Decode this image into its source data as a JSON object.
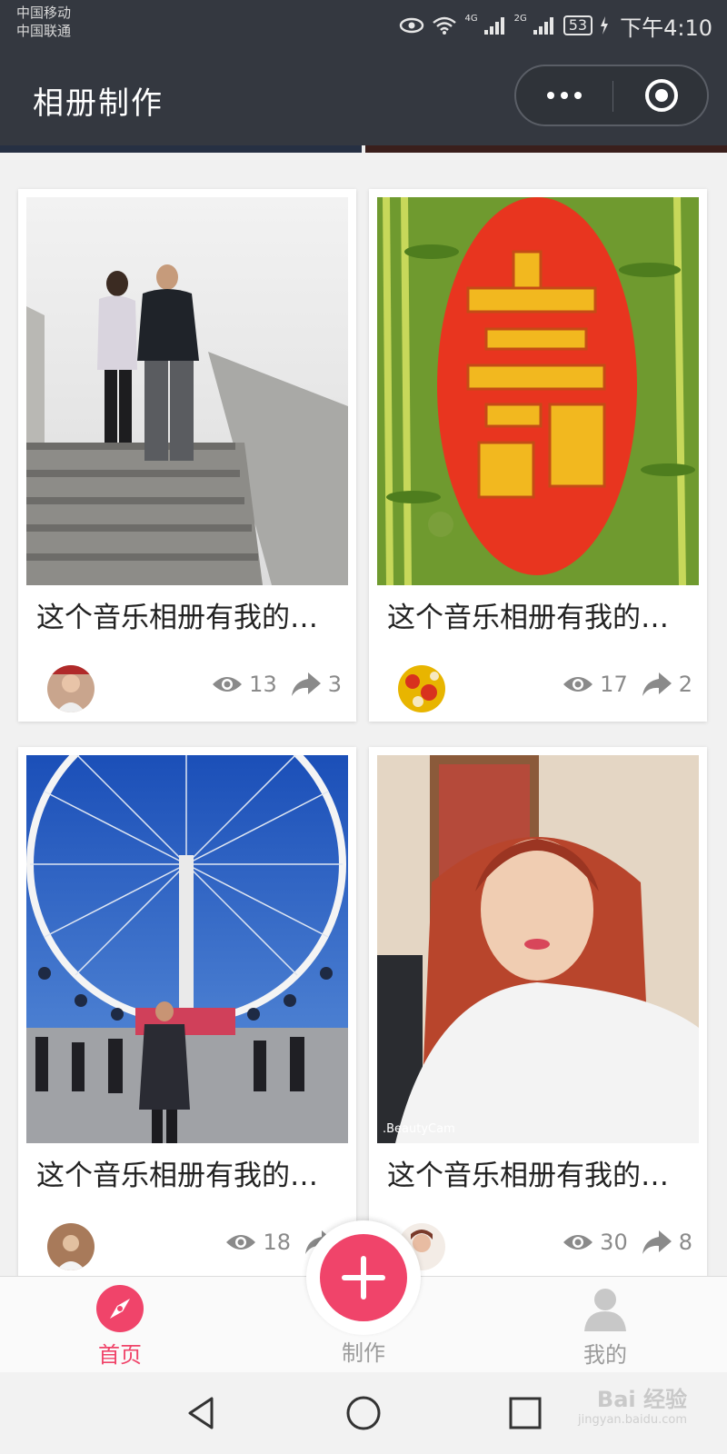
{
  "status_bar": {
    "carrier_1": "中国移动",
    "carrier_2": "中国联通",
    "net_1": "4G",
    "net_2": "2G",
    "battery": "53",
    "time": "下午4:10"
  },
  "nav": {
    "title": "相册制作"
  },
  "cards": [
    {
      "title": "这个音乐相册有我的…",
      "views": "13",
      "shares": "3"
    },
    {
      "title": "这个音乐相册有我的…",
      "views": "17",
      "shares": "2"
    },
    {
      "title": "这个音乐相册有我的…",
      "views": "18",
      "shares": ""
    },
    {
      "title": "这个音乐相册有我的…",
      "views": "30",
      "shares": "8"
    }
  ],
  "photo_texts": {
    "beautycam": ".BeautyCam"
  },
  "tabbar": {
    "home": "首页",
    "create": "制作",
    "mine": "我的"
  },
  "watermark": {
    "main": "Bai 经验",
    "sub": "jingyan.baidu.com"
  },
  "colors": {
    "accent": "#f0446a",
    "topbar": "#343840",
    "tab_inactive": "#9b9b9b"
  }
}
